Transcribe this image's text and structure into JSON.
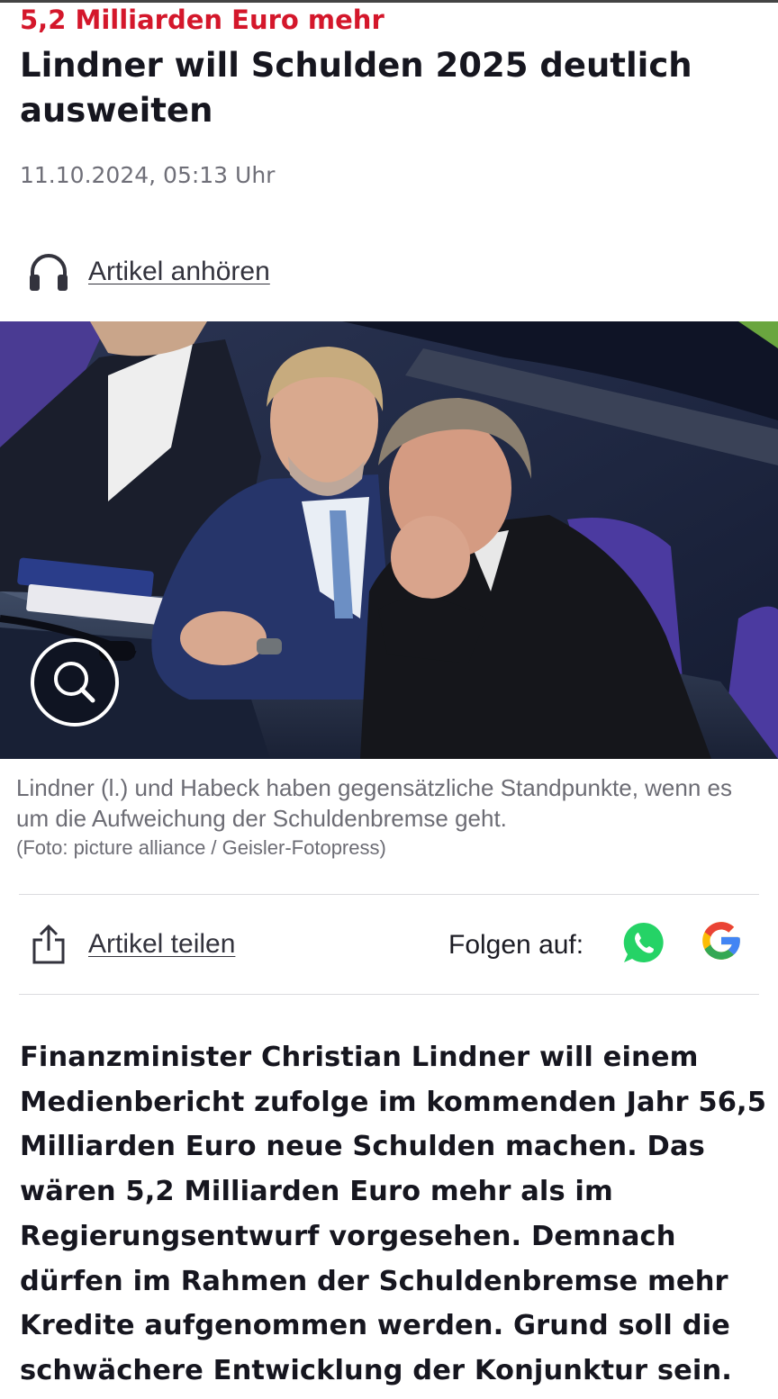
{
  "article": {
    "kicker": "5,2 Milliarden Euro mehr",
    "headline": "Lindner will Schulden 2025 deutlich ausweiten",
    "dateline": "11.10.2024, 05:13 Uhr",
    "lead": "Finanzminister Christian Lindner will einem Medienbericht zufolge im kommenden Jahr 56,5 Milliarden Euro neue Schulden machen. Das wären 5,2 Milliarden Euro mehr als im Regierungsentwurf vorgesehen. Demnach dürfen im Rahmen der Schuldenbremse mehr Kredite aufgenommen werden. Grund soll die schwächere Entwicklung der Konjunktur sein."
  },
  "audio": {
    "label": "Artikel anhören",
    "icon": "headphones-icon"
  },
  "image": {
    "caption": "Lindner (l.) und Habeck haben gegensätzliche Standpunkte, wenn es um die Aufweichung der Schuldenbremse geht.",
    "credit": "(Foto: picture alliance / Geisler-Fotopress)",
    "zoom_icon": "magnifier-icon"
  },
  "share": {
    "label": "Artikel teilen",
    "icon": "share-icon"
  },
  "follow": {
    "label": "Folgen auf:",
    "channels": [
      {
        "name": "whatsapp-icon",
        "color": "#25d366"
      },
      {
        "name": "google-icon",
        "colors": [
          "#4285f4",
          "#ea4335",
          "#fbbc05",
          "#34a853"
        ]
      }
    ]
  },
  "colors": {
    "kicker": "#d4172b",
    "text": "#16161f",
    "muted": "#6c6c74"
  }
}
